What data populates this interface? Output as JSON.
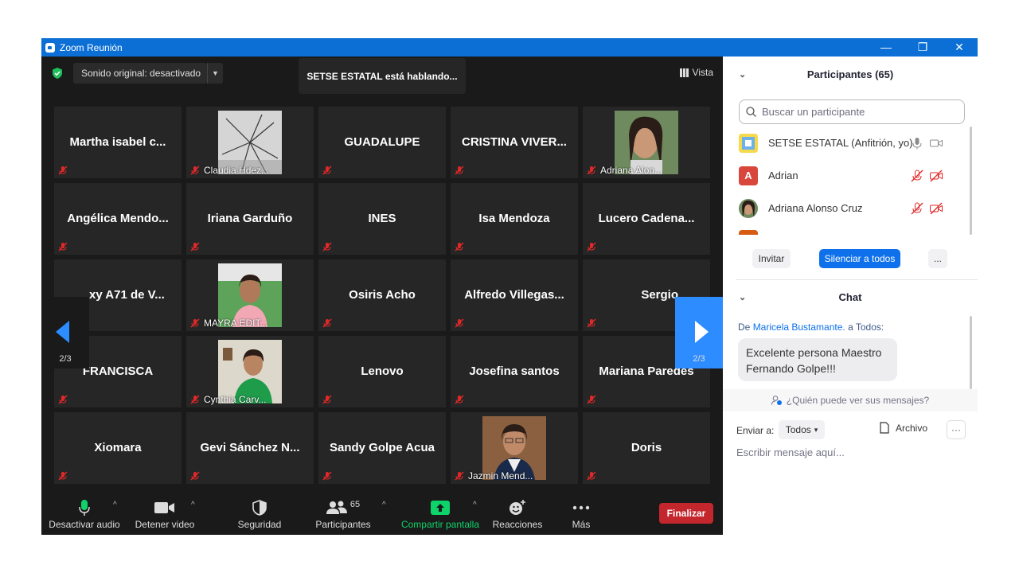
{
  "window": {
    "title": "Zoom Reunión",
    "controls": [
      "—",
      "❐",
      "✕"
    ]
  },
  "topbar": {
    "sound_label": "Sonido original: desactivado",
    "talking": "SETSE ESTATAL está hablando...",
    "vista_label": "Vista"
  },
  "tiles": [
    {
      "name": "Martha  isabel  c..."
    },
    {
      "label": "Claudia Hdez..."
    },
    {
      "name": "GUADALUPE"
    },
    {
      "name": "CRISTINA  VIVER..."
    },
    {
      "label": "Adriana Alon..."
    },
    {
      "name": "Angélica  Mendo..."
    },
    {
      "name": "Iriana Garduño"
    },
    {
      "name": "INES"
    },
    {
      "name": "Isa Mendoza"
    },
    {
      "name": "Lucero  Cadena..."
    },
    {
      "name": "xy A71 de V..."
    },
    {
      "label": "MAYRA EDIT..."
    },
    {
      "name": "Osiris Acho"
    },
    {
      "name": "Alfredo  Villegas..."
    },
    {
      "name": "Sergio"
    },
    {
      "name": "FRANCISCA"
    },
    {
      "label": "Cynthia Carv..."
    },
    {
      "name": "Lenovo"
    },
    {
      "name": "Josefina santos"
    },
    {
      "name": "Mariana Paredes"
    },
    {
      "name": "Xiomara"
    },
    {
      "name": "Gevi  Sánchez  N..."
    },
    {
      "name": "Sandy Golpe Acua"
    },
    {
      "label": "Jazmin Mend..."
    },
    {
      "name": "Doris"
    }
  ],
  "pager": {
    "left": "2/3",
    "right": "2/3"
  },
  "toolbar": {
    "audio": "Desactivar audio",
    "video": "Detener video",
    "security": "Seguridad",
    "participants": "Participantes",
    "participants_count": "65",
    "share": "Compartir pantalla",
    "reactions": "Reacciones",
    "more": "Más",
    "end": "Finalizar"
  },
  "participants_panel": {
    "title": "Participantes (65)",
    "search_placeholder": "Buscar un participante",
    "rows": [
      {
        "name": "SETSE ESTATAL (Anfitrión, yo)"
      },
      {
        "name": "Adrian",
        "initial": "A"
      },
      {
        "name": "Adriana Alonso Cruz"
      }
    ],
    "invite": "Invitar",
    "mute_all": "Silenciar a todos",
    "more": "..."
  },
  "chat": {
    "title": "Chat",
    "from_prefix": "De",
    "from_name": "Maricela Bustamante.",
    "from_suffix": "a Todos:",
    "message": "Excelente persona Maestro Fernando Golpe!!!",
    "who_can_see": "¿Quién puede ver sus mensajes?",
    "send_to_label": "Enviar a:",
    "send_to_value": "Todos",
    "file_label": "Archivo",
    "more": "···",
    "compose_placeholder": "Escribir mensaje aquí..."
  },
  "colors": {
    "titlebar": "#0b6fd6",
    "tile": "#262626",
    "end": "#c4262e",
    "accent": "#2d8cff",
    "share": "#0ed36a"
  }
}
